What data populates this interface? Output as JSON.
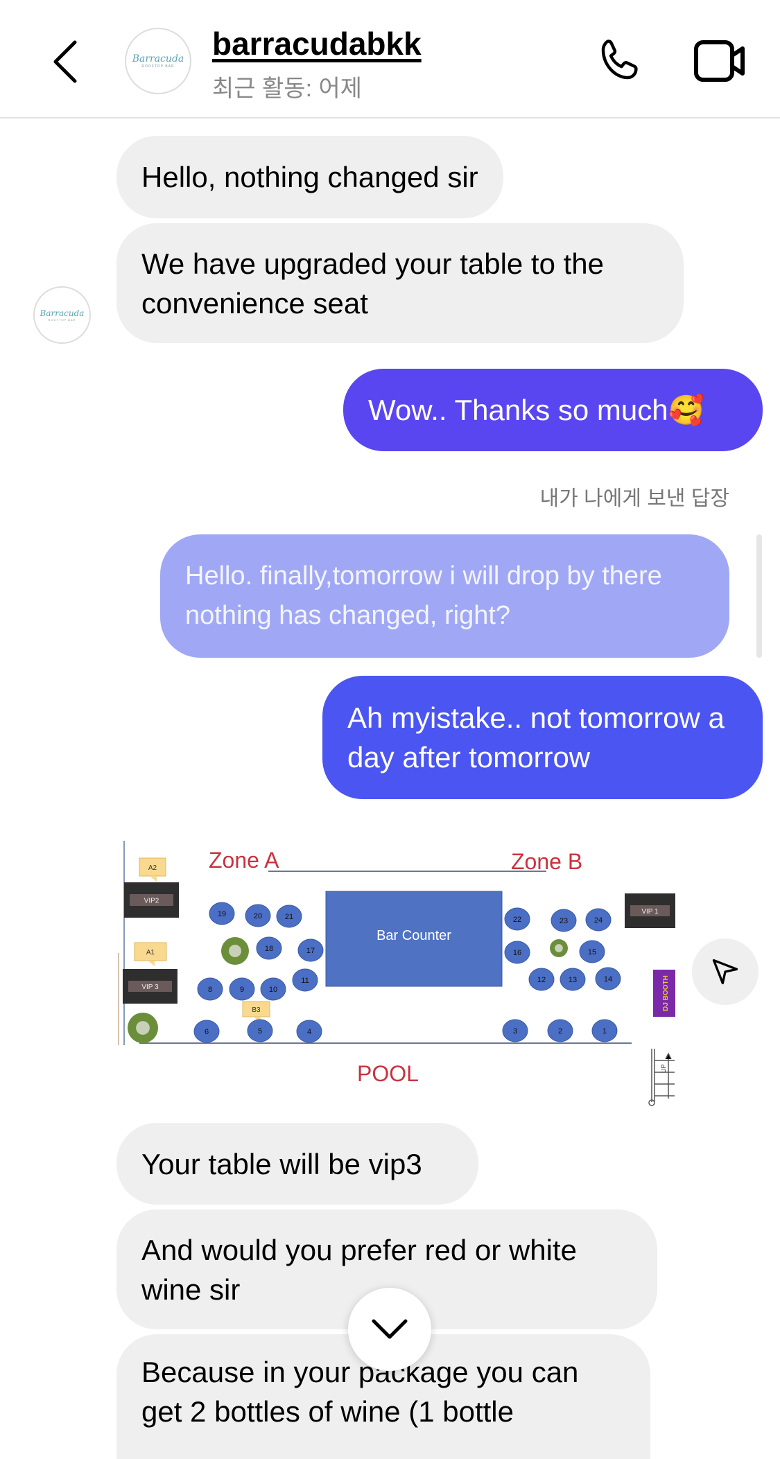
{
  "header": {
    "username": "barracudabkk",
    "status": "최근 활동: 어제",
    "avatar_logo": "Barracuda",
    "avatar_sub": "ROOFTOP BAR",
    "icons": [
      "chevron-left-icon",
      "phone-icon",
      "video-camera-icon"
    ]
  },
  "messages": [
    {
      "from": "them",
      "text": "Hello, nothing changed sir"
    },
    {
      "from": "them",
      "text": "We have upgraded your table to the convenience seat"
    },
    {
      "from": "me",
      "text": "Wow.. Thanks so much🥰"
    },
    {
      "from": "me",
      "reply_label": "내가 나에게 보낸 답장",
      "text": "Hello. finally,tomorrow i will drop by there nothing has changed, right?"
    },
    {
      "from": "me",
      "text": "Ah myistake.. not tomorrow a day after tomorrow"
    },
    {
      "from": "them",
      "type": "image"
    },
    {
      "from": "them",
      "text": "Your table will be vip3"
    },
    {
      "from": "them",
      "text": "And would you prefer red or white wine sir"
    },
    {
      "from": "them",
      "text": "Because in your package you can get 2 bottles of wine (1 bottle"
    }
  ],
  "floor_plan": {
    "zone_a": "Zone A",
    "zone_b": "Zone B",
    "bar": "Bar Counter",
    "pool": "POOL",
    "vip1": "VIP 1",
    "vip2": "VIP2",
    "vip3": "VIP 3",
    "a1": "A1",
    "a2": "A2",
    "b3": "B3",
    "dj": "DJ BOOTH",
    "up": "UP",
    "tables": [
      "19",
      "20",
      "21",
      "18",
      "17",
      "11",
      "8",
      "9",
      "10",
      "6",
      "5",
      "4",
      "22",
      "23",
      "24",
      "16",
      "15",
      "12",
      "13",
      "14",
      "3",
      "2",
      "1"
    ]
  },
  "colors": {
    "outgoing_1": "#5a46f0",
    "outgoing_reply": "#a0a8f6",
    "outgoing_2": "#4b55f1",
    "incoming": "#efefef",
    "table": "#4a6fc4",
    "bar": "#4f72c3",
    "zone": "#c8333f"
  }
}
